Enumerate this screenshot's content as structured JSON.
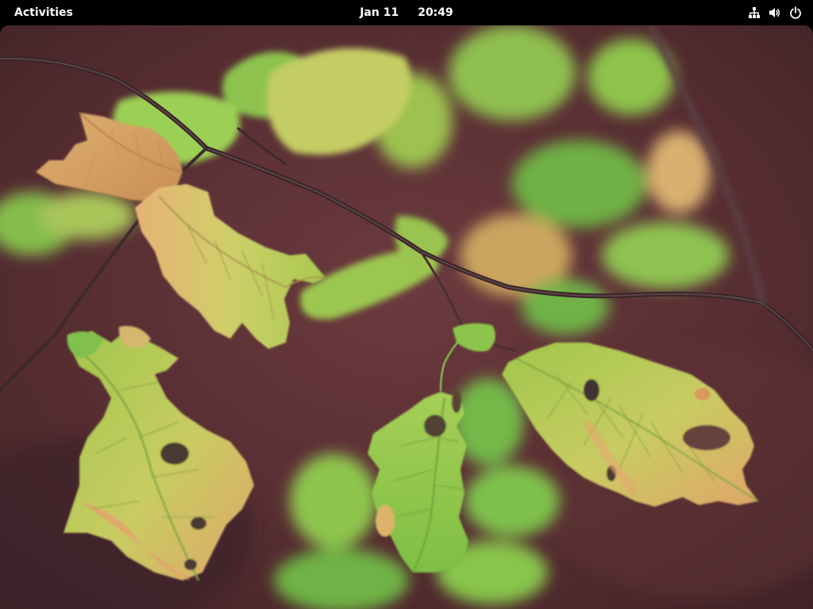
{
  "top_bar": {
    "activities_label": "Activities",
    "clock": {
      "date": "Jan 11",
      "time": "20:49"
    },
    "status_icons": [
      "network-wired-icon",
      "volume-icon",
      "power-icon"
    ]
  },
  "desktop": {
    "wallpaper": "autumn-leaves-photo"
  },
  "colors": {
    "top_bar_bg": "#000000",
    "top_bar_text": "#ffffff"
  }
}
